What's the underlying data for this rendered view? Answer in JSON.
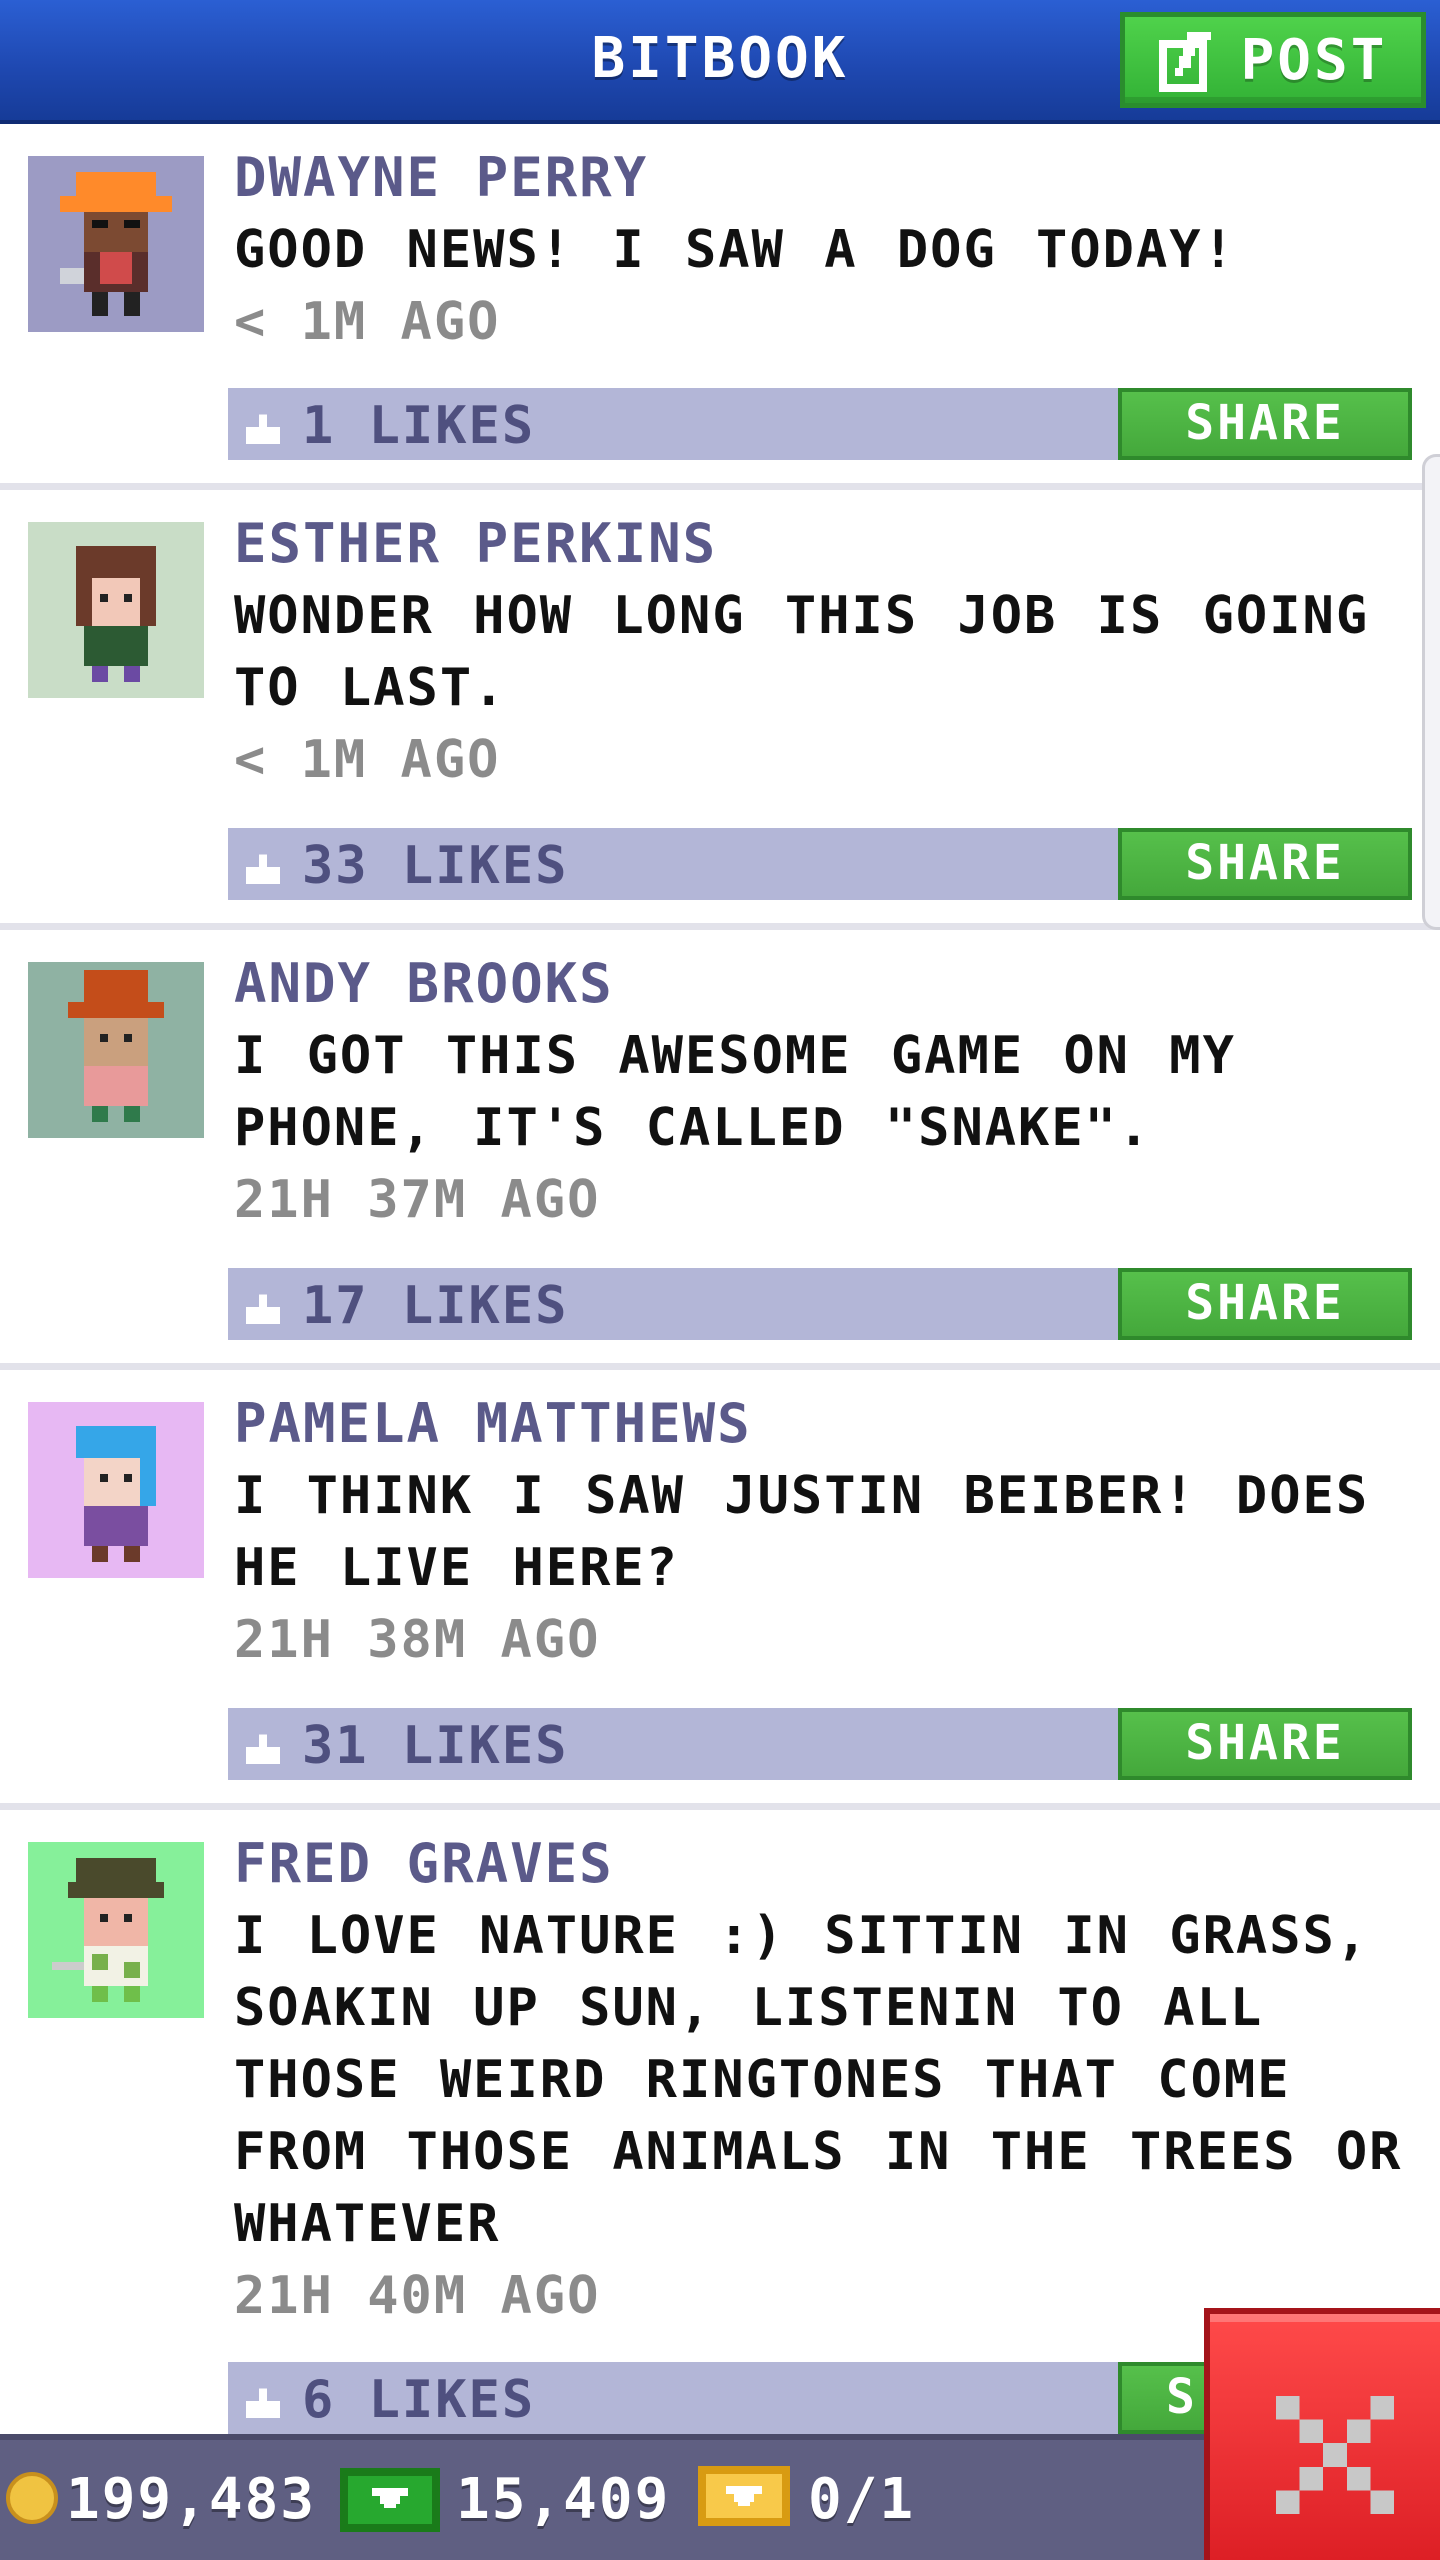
{
  "app": {
    "title": "BITBOOK",
    "post_label": "POST"
  },
  "posts": [
    {
      "name": "DWAYNE PERRY",
      "message": "GOOD NEWS! I SAW A DOG TODAY!",
      "time": "< 1M AGO",
      "likes": "1 LIKES",
      "share_label": "SHARE"
    },
    {
      "name": "ESTHER PERKINS",
      "message": "WONDER HOW LONG THIS JOB IS GOING TO LAST.",
      "time": "< 1M AGO",
      "likes": "33 LIKES",
      "share_label": "SHARE"
    },
    {
      "name": "ANDY BROOKS",
      "message": "I GOT THIS AWESOME GAME ON MY PHONE, IT'S CALLED \"SNAKE\".",
      "time": "21H 37M AGO",
      "likes": "17 LIKES",
      "share_label": "SHARE"
    },
    {
      "name": "PAMELA MATTHEWS",
      "message": "I THINK I SAW JUSTIN BEIBER! DOES HE LIVE HERE?",
      "time": "21H 38M AGO",
      "likes": "31 LIKES",
      "share_label": "SHARE"
    },
    {
      "name": "FRED GRAVES",
      "message": "I LOVE NATURE :) SITTIN IN GRASS, SOAKIN UP SUN, LISTENIN TO ALL THOSE WEIRD RINGTONES THAT COME FROM THOSE ANIMALS IN THE TREES OR WHATEVER",
      "time": "21H 40M AGO",
      "likes": "6 LIKES",
      "share_label": "S"
    }
  ],
  "status": {
    "coins": "199,483",
    "bux": "15,409",
    "vip": "0/1"
  },
  "icons": {
    "post": "edit-icon",
    "like": "thumbs-up-icon",
    "coin": "coin-icon",
    "bux": "bux-icon",
    "vip": "vip-ticket-icon",
    "close": "close-icon"
  },
  "colors": {
    "header": "#1f49b2",
    "post_button": "#3fc43f",
    "name": "#5b5a8a",
    "likebar": "#b3b6d7",
    "share": "#44a83b",
    "status_bar": "#5f5f82",
    "close": "#e12a2e"
  }
}
